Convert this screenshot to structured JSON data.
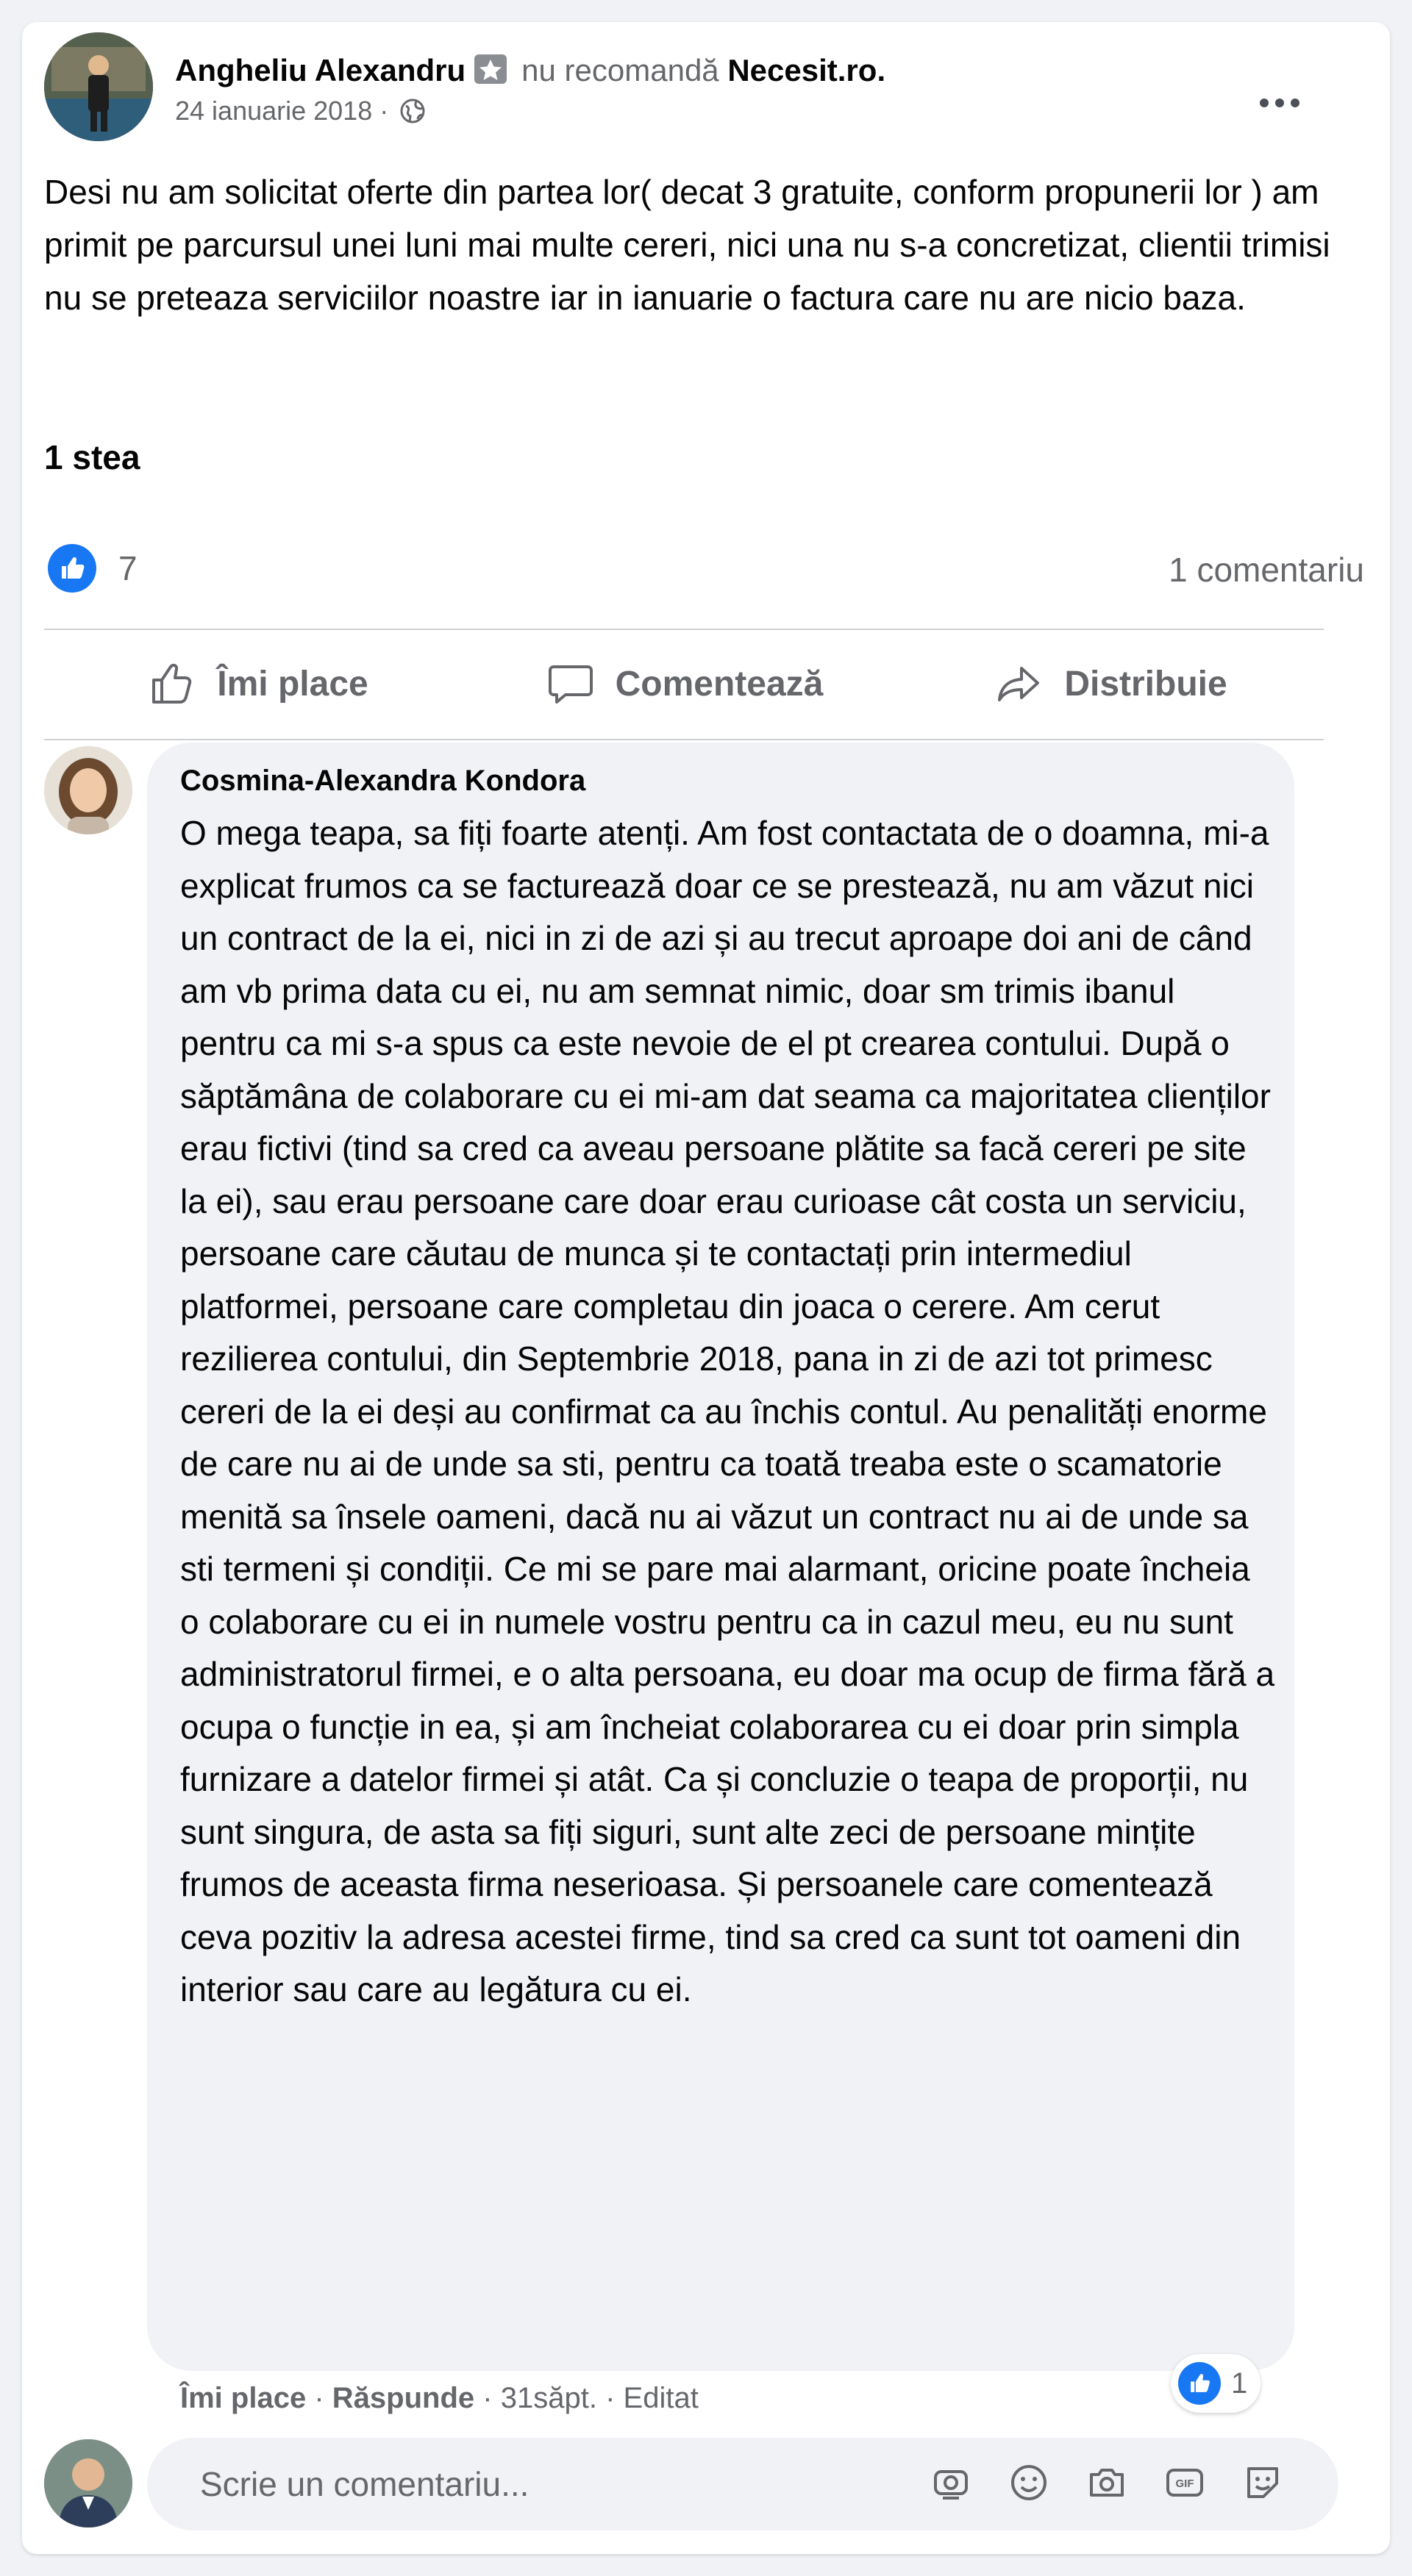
{
  "post": {
    "author_name": "Angheliu Alexandru",
    "recommends_text": "nu recomandă",
    "page_name": "Necesit.ro",
    "page_name_suffix": ".",
    "date": "24 ianuarie 2018",
    "meta_separator": "·",
    "privacy_icon": "globe-icon",
    "text": "Desi nu am solicitat oferte din partea lor( decat 3 gratuite, conform propunerii lor ) am primit pe parcursul unei luni mai multe cereri, nici una nu s-a concretizat, clientii trimisi nu se preteaza serviciilor noastre iar in ianuarie o factura care nu are nicio baza.",
    "rating": "1 stea",
    "like_count": "7",
    "comment_count": "1 comentariu"
  },
  "actions": {
    "like_label": "Îmi place",
    "comment_label": "Comentează",
    "share_label": "Distribuie"
  },
  "comment": {
    "author_name": "Cosmina-Alexandra Kondora",
    "text": "O mega teapa, sa fiți foarte atenți. Am fost contactata de o doamna, mi-a explicat frumos ca se facturează doar ce se prestează, nu am văzut nici un contract de la ei, nici in zi de azi și au trecut aproape doi ani de când am vb prima data cu ei, nu am semnat nimic, doar sm trimis ibanul pentru ca mi s-a spus ca este nevoie de el pt crearea contului. După o săptămâna de colaborare cu ei mi-am dat seama ca majoritatea clienților erau fictivi (tind sa cred ca aveau persoane plătite sa facă cereri pe site la ei), sau erau persoane care doar erau curioase cât costa un serviciu, persoane care căutau de munca și te contactați prin intermediul platformei, persoane care completau din joaca o cerere. Am cerut rezilierea contului, din Septembrie 2018, pana in zi de azi tot primesc cereri de la ei deși au confirmat ca au închis contul. Au penalități enorme de care nu ai de unde sa sti, pentru ca toată treaba este o scamatorie menită sa însele oameni, dacă nu ai văzut un contract nu ai de unde sa sti termeni și condiții. Ce mi se pare mai alarmant, oricine poate încheia o colaborare cu ei in numele vostru pentru ca in cazul meu, eu nu sunt administratorul firmei, e o alta persoana, eu doar ma ocup de firma fără a ocupa o funcție in ea, și am încheiat colaborarea cu ei doar prin simpla furnizare a datelor firmei și atât. Ca și concluzie o teapa de proporții, nu sunt singura, de asta sa fiți siguri, sunt alte zeci de persoane mințite frumos de aceasta firma neserioasa. Și persoanele care comentează ceva pozitiv la adresa acestei firme, tind sa cred ca sunt tot oameni din interior sau care au legătura cu ei.",
    "like_label": "Îmi place",
    "reply_label": "Răspunde",
    "time": "31săpt.",
    "edited_label": "Editat",
    "separator": "·",
    "reaction_count": "1"
  },
  "composer": {
    "placeholder": "Scrie un comentariu...",
    "icons": [
      "avatar-sticker-icon",
      "emoji-icon",
      "camera-icon",
      "gif-icon",
      "sticker-icon"
    ]
  },
  "colors": {
    "brand_blue": "#1877f2",
    "secondary_text": "#65676b",
    "bubble_bg": "#f0f2f5"
  }
}
